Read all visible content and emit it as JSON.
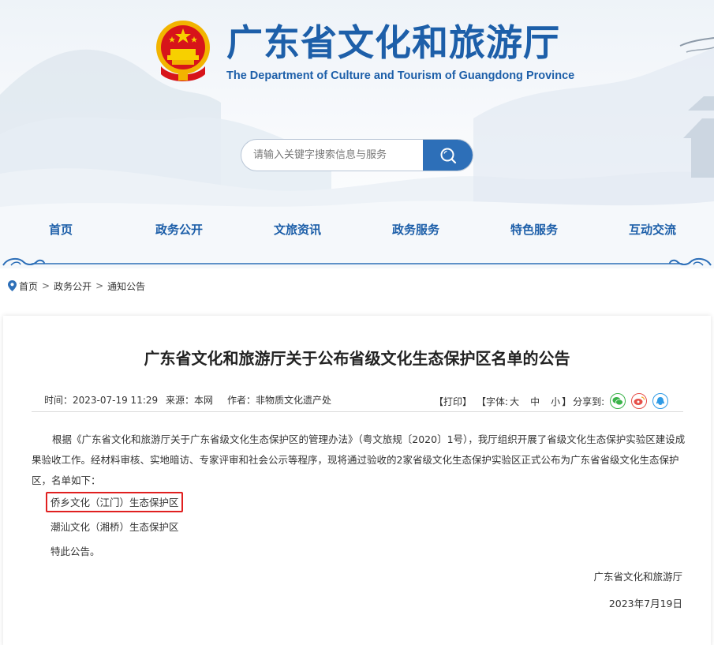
{
  "site": {
    "title": "广东省文化和旅游厅",
    "subtitle": "The Department of Culture and Tourism of Guangdong Province"
  },
  "search": {
    "placeholder": "请输入关键字搜索信息与服务"
  },
  "nav": {
    "items": [
      {
        "label": "首页"
      },
      {
        "label": "政务公开"
      },
      {
        "label": "文旅资讯"
      },
      {
        "label": "政务服务"
      },
      {
        "label": "特色服务"
      },
      {
        "label": "互动交流"
      }
    ]
  },
  "breadcrumb": {
    "items": [
      "首页",
      "政务公开",
      "通知公告"
    ],
    "separator": ">"
  },
  "article": {
    "title": "广东省文化和旅游厅关于公布省级文化生态保护区名单的公告",
    "time": "时间：2023-07-19 11:29",
    "source": "来源：本网",
    "author": "作者：非物质文化遗产处",
    "print": "【打印】",
    "font_prefix": "【字体:",
    "font_large": "大",
    "font_medium": "中",
    "font_small": "小",
    "font_suffix": "】",
    "share_label": "分享到:",
    "share_icons": [
      "wechat-icon",
      "weibo-icon",
      "qq-icon"
    ],
    "paragraph": "根据《广东省文化和旅游厅关于广东省级文化生态保护区的管理办法》（粤文旅规〔2020〕1号），我厅组织开展了省级文化生态保护实验区建设成果验收工作。经材料审核、实地暗访、专家评审和社会公示等程序，现将通过验收的2家省级文化生态保护实验区正式公布为广东省省级文化生态保护区，名单如下：",
    "items": [
      "侨乡文化（江门）生态保护区",
      "潮汕文化（湘桥）生态保护区"
    ],
    "closing": "特此公告。",
    "signer": "广东省文化和旅游厅",
    "date": "2023年7月19日"
  },
  "colors": {
    "brand_blue": "#1d5fa9",
    "search_button": "#2d6fb8",
    "highlight_red": "#e02020"
  }
}
